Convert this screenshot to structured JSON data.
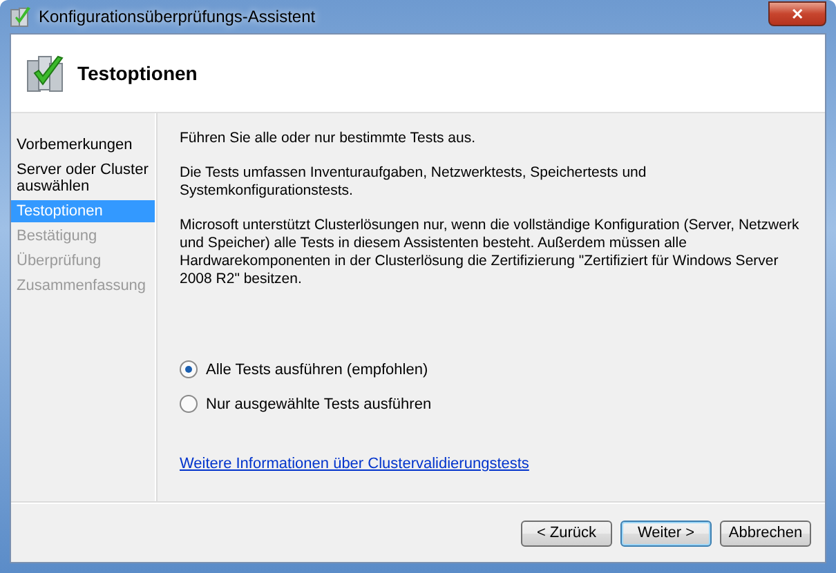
{
  "window": {
    "title": "Konfigurationsüberprüfungs-Assistent",
    "close": "✕"
  },
  "header": {
    "title": "Testoptionen"
  },
  "steps": [
    {
      "label": "Vorbemerkungen",
      "selected": false,
      "disabled": false
    },
    {
      "label": "Server oder Cluster auswählen",
      "selected": false,
      "disabled": false
    },
    {
      "label": "Testoptionen",
      "selected": true,
      "disabled": false
    },
    {
      "label": "Bestätigung",
      "selected": false,
      "disabled": true
    },
    {
      "label": "Überprüfung",
      "selected": false,
      "disabled": true
    },
    {
      "label": "Zusammenfassung",
      "selected": false,
      "disabled": true
    }
  ],
  "paragraphs": [
    "Führen Sie alle oder nur bestimmte Tests aus.",
    "Die Tests umfassen Inventuraufgaben, Netzwerktests, Speichertests und Systemkonfigurationstests.",
    "Microsoft unterstützt Clusterlösungen nur, wenn die vollständige Konfiguration (Server, Netzwerk und Speicher) alle Tests in diesem Assistenten besteht. Außerdem müssen alle Hardwarekomponenten in der Clusterlösung die Zertifizierung \"Zertifiziert für Windows Server 2008 R2\" besitzen."
  ],
  "options": [
    {
      "label": "Alle Tests ausführen (empfohlen)",
      "selected": true
    },
    {
      "label": "Nur ausgewählte Tests ausführen",
      "selected": false
    }
  ],
  "link": "Weitere Informationen über Clustervalidierungstests",
  "buttons": [
    {
      "label": "< Zurück",
      "default": false
    },
    {
      "label": "Weiter >",
      "default": true
    },
    {
      "label": "Abbrechen",
      "default": false
    }
  ]
}
